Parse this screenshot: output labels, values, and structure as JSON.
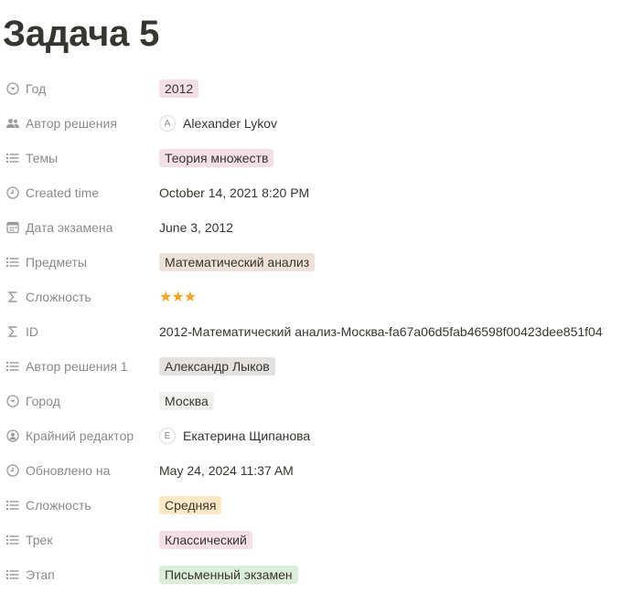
{
  "page": {
    "title": "Задача 5"
  },
  "properties": [
    {
      "label": "Год",
      "icon": "select-icon",
      "type": "tag",
      "color": "pink",
      "value": "2012"
    },
    {
      "label": "Автор решения",
      "icon": "people-icon",
      "type": "person",
      "initial": "A",
      "value": "Alexander Lykov"
    },
    {
      "label": "Темы",
      "icon": "list-icon",
      "type": "tag",
      "color": "pink",
      "value": "Теория множеств"
    },
    {
      "label": "Created time",
      "icon": "clock-icon",
      "type": "text",
      "value": "October 14, 2021 8:20 PM"
    },
    {
      "label": "Дата экзамена",
      "icon": "calendar-icon",
      "type": "text",
      "value": "June 3, 2012"
    },
    {
      "label": "Предметы",
      "icon": "list-icon",
      "type": "tag",
      "color": "brown",
      "value": "Математический анализ"
    },
    {
      "label": "Сложность",
      "icon": "sigma-icon",
      "type": "stars",
      "value": "★★★"
    },
    {
      "label": "ID",
      "icon": "sigma-icon",
      "type": "text",
      "value": "2012-Математический анализ-Москва-fa67a06d5fab46598f00423dee851f04"
    },
    {
      "label": "Автор решения 1",
      "icon": "list-icon",
      "type": "tag",
      "color": "gray",
      "value": "Александр Лыков"
    },
    {
      "label": "Город",
      "icon": "select-icon",
      "type": "tag",
      "color": "lightgray",
      "value": "Москва"
    },
    {
      "label": "Крайний редактор",
      "icon": "person-circle-icon",
      "type": "person",
      "initial": "E",
      "value": "Екатерина Щипанова"
    },
    {
      "label": "Обновлено на",
      "icon": "clock-icon",
      "type": "text",
      "value": "May 24, 2024 11:37 AM"
    },
    {
      "label": "Сложность",
      "icon": "list-icon",
      "type": "tag",
      "color": "yellow",
      "value": "Средняя"
    },
    {
      "label": "Трек",
      "icon": "list-icon",
      "type": "tag",
      "color": "pink",
      "value": "Классический"
    },
    {
      "label": "Этап",
      "icon": "list-icon",
      "type": "tag",
      "color": "green",
      "value": "Письменный экзамен"
    }
  ],
  "colors": {
    "label_text": "#8b8a86",
    "value_text": "#37352f",
    "star": "#f2a52d",
    "tag_pink": "#f5dfe7",
    "tag_brown": "#eee0da",
    "tag_gray": "#e3e2e0",
    "tag_lightgray": "#f1f1ef",
    "tag_yellow": "#fbe9c6",
    "tag_green": "#dbeddb"
  }
}
